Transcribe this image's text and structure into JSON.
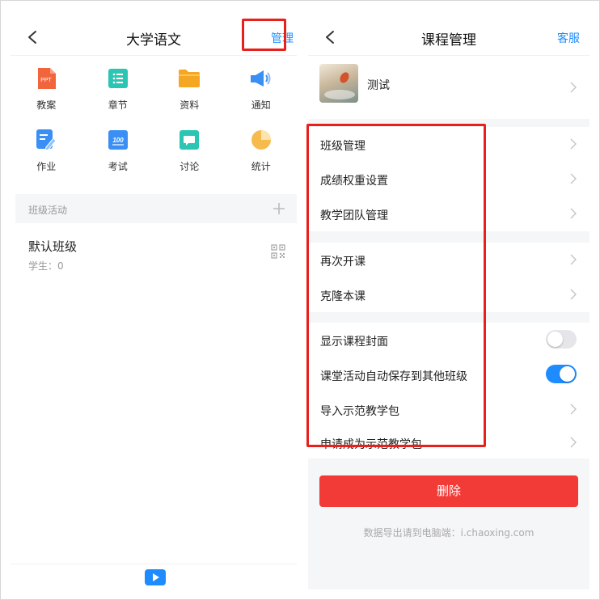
{
  "left": {
    "title": "大学语文",
    "action": "管理",
    "grid": [
      {
        "label": "教案",
        "icon": "ppt-icon"
      },
      {
        "label": "章节",
        "icon": "chapter-list-icon"
      },
      {
        "label": "资料",
        "icon": "folder-icon"
      },
      {
        "label": "通知",
        "icon": "megaphone-icon"
      },
      {
        "label": "作业",
        "icon": "homework-icon"
      },
      {
        "label": "考试",
        "icon": "exam-score-icon"
      },
      {
        "label": "讨论",
        "icon": "chat-bubble-icon"
      },
      {
        "label": "统计",
        "icon": "pie-chart-icon"
      }
    ],
    "ppt_text": "PPT",
    "score_text": "100",
    "section_title": "班级活动",
    "class_name": "默认班级",
    "students": "学生：0"
  },
  "right": {
    "title": "课程管理",
    "action": "客服",
    "course_name": "测试",
    "group1": [
      "班级管理",
      "成绩权重设置",
      "教学团队管理"
    ],
    "group2": [
      "再次开课",
      "克隆本课"
    ],
    "group3": {
      "show_cover": {
        "label": "显示课程封面",
        "on": false
      },
      "auto_save": {
        "label": "课堂活动自动保存到其他班级",
        "on": true
      },
      "import_pkg": "导入示范教学包",
      "apply_pkg": "申请成为示范教学包"
    },
    "delete_label": "删除",
    "footnote": "数据导出请到电脑端：i.chaoxing.com"
  },
  "colors": {
    "accent": "#1e8cff",
    "danger": "#f23a36",
    "highlight": "#e8201c"
  }
}
